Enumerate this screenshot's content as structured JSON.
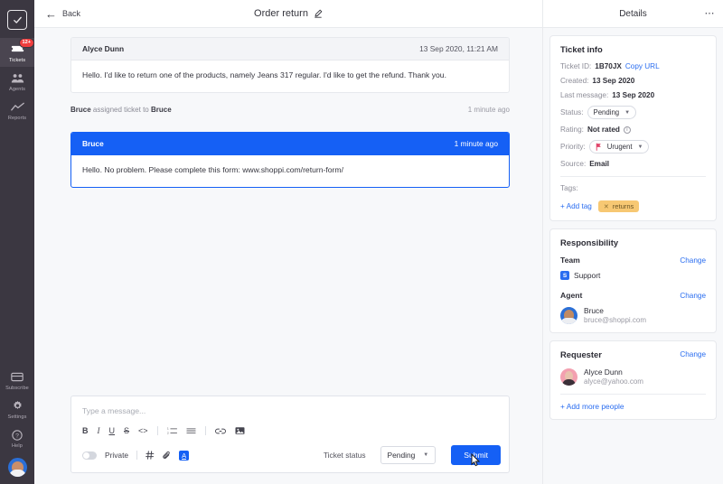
{
  "sidebar": {
    "logo_icon": "checkbox-logo-icon",
    "items": [
      {
        "label": "Tickets",
        "icon": "ticket-icon",
        "badge": "12+",
        "active": true
      },
      {
        "label": "Agents",
        "icon": "agents-icon",
        "badge": "",
        "active": false
      },
      {
        "label": "Reports",
        "icon": "reports-chart-icon",
        "badge": "",
        "active": false
      }
    ],
    "bottom_items": [
      {
        "label": "Subscribe",
        "icon": "card-icon"
      },
      {
        "label": "Settings",
        "icon": "gear-icon"
      },
      {
        "label": "Help",
        "icon": "question-circle-icon"
      }
    ],
    "avatar": "user-avatar"
  },
  "topbar": {
    "back_label": "Back",
    "back_icon": "arrow-left-icon",
    "title": "Order return",
    "edit_icon": "pencil-icon"
  },
  "thread": {
    "messages": [
      {
        "author": "Alyce Dunn",
        "time": "13 Sep 2020, 11:21 AM",
        "body": "Hello. I'd like to return one of the products, namely Jeans 317 regular. I'd like to get the refund. Thank you.",
        "outgoing": false
      },
      {
        "author": "Bruce",
        "time": "1 minute ago",
        "body": "Hello. No problem. Please complete this form: www.shoppi.com/return-form/",
        "outgoing": true
      }
    ],
    "event": {
      "actor": "Bruce",
      "text": "assigned ticket to",
      "target": "Bruce",
      "time": "1 minute ago"
    }
  },
  "composer": {
    "placeholder": "Type a message...",
    "value": "",
    "format_buttons": [
      {
        "label": "B",
        "icon": "bold-icon"
      },
      {
        "label": "I",
        "icon": "italic-icon"
      },
      {
        "label": "U",
        "icon": "underline-icon"
      },
      {
        "label": "S",
        "icon": "strikethrough-icon"
      },
      {
        "label": "<>",
        "icon": "code-icon"
      },
      {
        "label": "",
        "icon": "ordered-list-icon"
      },
      {
        "label": "",
        "icon": "bullet-list-icon"
      },
      {
        "label": "",
        "icon": "link-icon"
      },
      {
        "label": "",
        "icon": "image-icon"
      }
    ],
    "private_label": "Private",
    "hash_icon": "hashtag-icon",
    "attach_icon": "paperclip-icon",
    "text_color_icon": "text-color-icon",
    "text_color_letter": "A",
    "status_label": "Ticket status",
    "status_value": "Pending",
    "submit_label": "Submit",
    "cursor_icon": "mouse-cursor-icon"
  },
  "details": {
    "header": "Details",
    "more_icon": "more-options-icon",
    "ticket_info": {
      "title": "Ticket info",
      "ticket_id_label": "Ticket ID:",
      "ticket_id_value": "1B70JX",
      "copy_url_label": "Copy URL",
      "created_label": "Created:",
      "created_value": "13 Sep 2020",
      "last_message_label": "Last message:",
      "last_message_value": "13 Sep 2020",
      "status_label": "Status:",
      "status_value": "Pending",
      "rating_label": "Rating:",
      "rating_value": "Not rated",
      "rating_info_icon": "info-icon",
      "priority_label": "Priority:",
      "priority_value": "Urugent",
      "priority_icon": "priority-flag-icon",
      "source_label": "Source:",
      "source_value": "Email",
      "tags_label": "Tags:",
      "add_tag_label": "+ Add tag",
      "tags": [
        {
          "name": "returns",
          "remove_icon": "close-icon"
        }
      ]
    },
    "responsibility": {
      "title": "Responsibility",
      "team_label": "Team",
      "team_change_label": "Change",
      "team_badge": "S",
      "team_name": "Support",
      "agent_label": "Agent",
      "agent_change_label": "Change",
      "agent_name": "Bruce",
      "agent_email": "bruce@shoppi.com"
    },
    "requester": {
      "title": "Requester",
      "change_label": "Change",
      "name": "Alyce Dunn",
      "email": "alyce@yahoo.com",
      "add_more_label": "+ Add more people"
    }
  },
  "colors": {
    "accent_blue": "#1560f5",
    "link_blue": "#2a6df0",
    "rail_bg": "#3b3741",
    "badge_red": "#f03e3e",
    "tag_amber": "#f7c873",
    "page_bg": "#f7f8fa"
  }
}
